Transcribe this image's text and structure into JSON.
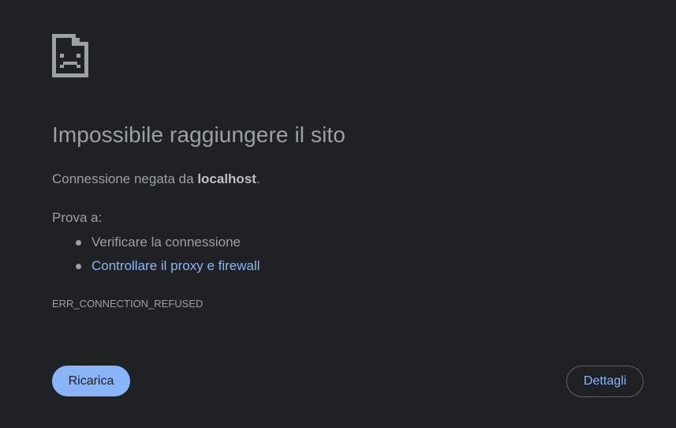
{
  "icon": "sad-page-icon",
  "title": "Impossibile raggiungere il sito",
  "description": {
    "prefix": "Connessione negata da ",
    "host": "localhost",
    "suffix": "."
  },
  "try_label": "Prova a:",
  "suggestions": [
    {
      "text": "Verificare la connessione",
      "is_link": false
    },
    {
      "text": "Controllare il proxy e firewall",
      "is_link": true
    }
  ],
  "error_code": "ERR_CONNECTION_REFUSED",
  "buttons": {
    "reload_label": "Ricarica",
    "details_label": "Dettagli"
  },
  "colors": {
    "background": "#202124",
    "text": "#9aa0a6",
    "link": "#8ab4f8",
    "primary_button": "#8ab4f8"
  }
}
